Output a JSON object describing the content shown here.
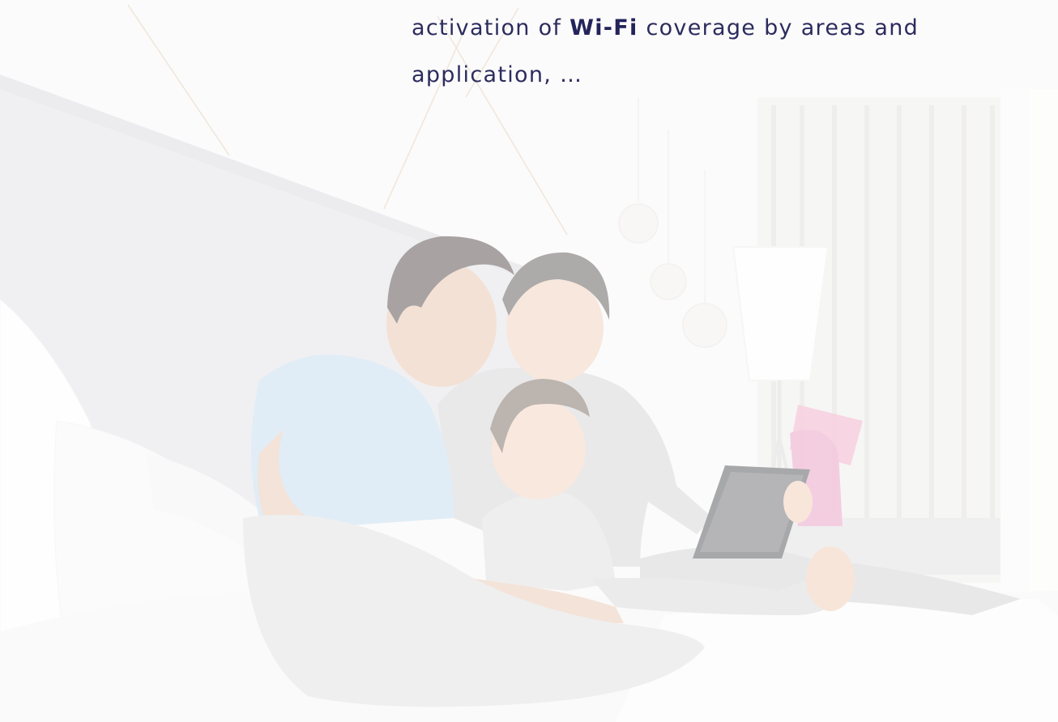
{
  "content": {
    "caption": {
      "prefix": "activation of ",
      "emphasis": "Wi-Fi",
      "suffix": " coverage by areas and application, …"
    }
  },
  "colors": {
    "text": "#2b2c5e",
    "emphasis": "#23245a",
    "background": "#f7f6f4"
  },
  "image": {
    "semantic": "family-in-bed-with-tablet-photo"
  }
}
